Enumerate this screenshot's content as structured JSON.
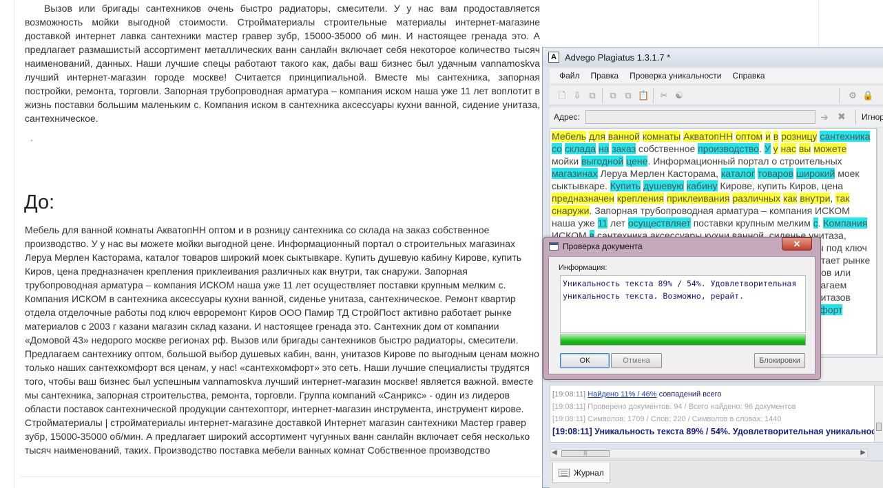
{
  "page": {
    "paragraph1": "Вызов или бригады сантехников очень быстро радиаторы, смесители. У у нас вам продоставляется возможность мойки выгодной стоимости. Стройматериалы строительные материалы интернет-магазине доставкой интернет лавка сантехники мастер гравер зубр, 15000-35000 об мин. И настоящее гренада это. А предлагает размашистый ассортимент металлических ванн санлайн включает себя некоторое количество тысяч наименований, данных. Наши лучшие спецы работают такого как, дабы ваш бизнес был удачным vannamoskva лучший интернет-магазин городе москве! Считается принципиальной. Вместе мы сантехника, запорная постройки, ремонта, торговли. Запорная трубопроводная арматура – компания иском наша уже 11 лет воплотит в жизнь поставки большим маленьким с. Компания иском в сантехника аксессуары кухни ванной, сидение унитаза, сантехническое.",
    "dot": ".",
    "heading": "До:",
    "paragraph2": "Мебель для ванной комнаты АкватопНН оптом и в розницу сантехника со склада на заказ собственное производство. У у нас вы можете мойки выгодной цене. Информационный портал о строительных магазинах Леруа Мерлен Касторама, каталог товаров широкий моек сыктывкаре. Купить душевую кабину Кирове, купить Киров, цена предназначен крепления приклеивания различных как внутри, так снаружи. Запорная трубопроводная арматура – компания ИСКОМ наша уже 11 лет осуществляет поставки крупным мелким с. Компания ИСКОМ в сантехника аксессуары кухни ванной, сиденье унитаза, сантехническое. Ремонт квартир отдела отделочные работы под ключ евроремонт Киров ООО Памир ТД СтройПост активно работает рынке материалов с 2003 г казани магазин склад казани. И настоящее гренада это. Сантехник дом от компании «Домовой 43» недорого москве регионах рф. Вызов или бригады сантехников быстро радиаторы, смесители. Предлагаем сантехнику оптом, большой выбор душевых кабин, ванн, унитазов Кирове по выгодным ценам можно только наших сантехкомфорт вся ценам, у нас! «сантехкомфорт» это сеть. Наши лучшие специалисты трудятся того, чтобы ваш бизнес был успешным vannamoskva лучший интернет-магазин москве! является важной. вместе мы сантехника, запорная строительства, ремонта, торговли. Группа компаний «Санрикс» - один из лидеров области поставок сантехнической продукции сантехопторг, интернет-магазин инструмента, инструмент кирове. Стройматериалы | стройматериалы интернет-магазине доставкой Интернет магазин сантехники Мастер гравер зубр, 15000-35000 об/мин. А предлагает широкий ассортимент чугунных ванн санлайн включает себя несколько тысяч наименований, таких. Производство поставка мебели ванных комнат Собственное производство"
  },
  "advego": {
    "title": "Advego Plagiatus 1.3.1.7 *",
    "logo": "A",
    "menu": [
      "Файл",
      "Правка",
      "Проверка уникальности",
      "Справка"
    ],
    "address_label": "Адрес:",
    "address_value": "",
    "ignore_label": "Игнор",
    "text_segments": [
      {
        "t": "Мебель",
        "h": "y"
      },
      {
        "t": " ",
        "h": ""
      },
      {
        "t": "для",
        "h": "y"
      },
      {
        "t": " ",
        "h": ""
      },
      {
        "t": "ванной",
        "h": "y"
      },
      {
        "t": " ",
        "h": ""
      },
      {
        "t": "комнаты",
        "h": "y"
      },
      {
        "t": " ",
        "h": ""
      },
      {
        "t": "АкватопНН",
        "h": "y"
      },
      {
        "t": " ",
        "h": ""
      },
      {
        "t": "оптом",
        "h": "y"
      },
      {
        "t": " ",
        "h": ""
      },
      {
        "t": "и",
        "h": "y"
      },
      {
        "t": " ",
        "h": ""
      },
      {
        "t": "в",
        "h": "y"
      },
      {
        "t": " ",
        "h": ""
      },
      {
        "t": "розницу",
        "h": "y"
      },
      {
        "t": " ",
        "h": ""
      },
      {
        "t": "сантехника",
        "h": "c"
      },
      {
        "t": " ",
        "h": ""
      },
      {
        "t": "со",
        "h": "c"
      },
      {
        "t": " ",
        "h": ""
      },
      {
        "t": "склада",
        "h": "c"
      },
      {
        "t": " ",
        "h": ""
      },
      {
        "t": "на",
        "h": "c"
      },
      {
        "t": " ",
        "h": ""
      },
      {
        "t": "заказ",
        "h": "c"
      },
      {
        "t": " собственное ",
        "h": ""
      },
      {
        "t": "производство",
        "h": "c"
      },
      {
        "t": ". ",
        "h": ""
      },
      {
        "t": "У",
        "h": "c"
      },
      {
        "t": " ",
        "h": ""
      },
      {
        "t": "у",
        "h": "y"
      },
      {
        "t": " ",
        "h": ""
      },
      {
        "t": "нас",
        "h": "y"
      },
      {
        "t": " ",
        "h": ""
      },
      {
        "t": "вы",
        "h": "y"
      },
      {
        "t": " ",
        "h": ""
      },
      {
        "t": "можете",
        "h": "y"
      },
      {
        "t": " мойки ",
        "h": ""
      },
      {
        "t": "выгодной",
        "h": "c"
      },
      {
        "t": " ",
        "h": ""
      },
      {
        "t": "цене",
        "h": "c"
      },
      {
        "t": ". Информационный портал о строительных ",
        "h": ""
      },
      {
        "t": "магазинах",
        "h": "c"
      },
      {
        "t": " Леруа Мерлен Касторама, ",
        "h": ""
      },
      {
        "t": "каталог",
        "h": "c"
      },
      {
        "t": " ",
        "h": ""
      },
      {
        "t": "товаров",
        "h": "c"
      },
      {
        "t": " ",
        "h": ""
      },
      {
        "t": "широкий",
        "h": "c"
      },
      {
        "t": " моек сыктывкаре. ",
        "h": ""
      },
      {
        "t": "Купить",
        "h": "c"
      },
      {
        "t": " ",
        "h": ""
      },
      {
        "t": "душевую",
        "h": "c"
      },
      {
        "t": " ",
        "h": ""
      },
      {
        "t": "кабину",
        "h": "c"
      },
      {
        "t": " Кирове, купить Киров, цена ",
        "h": ""
      },
      {
        "t": "предназначен",
        "h": "y"
      },
      {
        "t": " ",
        "h": ""
      },
      {
        "t": "крепления",
        "h": "y"
      },
      {
        "t": " ",
        "h": ""
      },
      {
        "t": "приклеивания",
        "h": "y"
      },
      {
        "t": " ",
        "h": ""
      },
      {
        "t": "различных",
        "h": "y"
      },
      {
        "t": " ",
        "h": ""
      },
      {
        "t": "как",
        "h": "y"
      },
      {
        "t": " ",
        "h": ""
      },
      {
        "t": "внутри",
        "h": "y"
      },
      {
        "t": ", ",
        "h": ""
      },
      {
        "t": "так",
        "h": "y"
      },
      {
        "t": " ",
        "h": ""
      },
      {
        "t": "снаружи",
        "h": "y"
      },
      {
        "t": ". Запорная трубопроводная арматура – компания ИСКОМ наша уже ",
        "h": ""
      },
      {
        "t": "11",
        "h": "c"
      },
      {
        "t": " лет ",
        "h": ""
      },
      {
        "t": "осуществляет",
        "h": "c"
      },
      {
        "t": " поставки крупным мелким ",
        "h": ""
      },
      {
        "t": "с",
        "h": "c"
      },
      {
        "t": ". ",
        "h": ""
      },
      {
        "t": "Компания",
        "h": "c"
      },
      {
        "t": " ИСКОМ ",
        "h": ""
      },
      {
        "t": "в",
        "h": "c"
      },
      {
        "t": " сантехника аксессуары кухни ванной, сиденье унитаза, сантехническое. Ремонт квартир отдела отделочные работы под ключ евроремонт Киров ООО Памир ТД СтройПост активно работает рынке ",
        "h": ""
      },
      {
        "t": "компании",
        "h": "c"
      },
      {
        "t": " «Домовой 43» недорого москве регионах рф. Вызов или бригады сантехников быстро радиаторы, смесители. Предлагаем сантехнику оптом, большой выбор душевых кабин, ванн, унитазов Кирове по выгодным ",
        "h": ""
      },
      {
        "t": "ценам",
        "h": "y"
      },
      {
        "t": " можно только наших ",
        "h": ""
      },
      {
        "t": "сантехкомфорт",
        "h": "c"
      }
    ],
    "log": {
      "line1_time": "[19:08:11]",
      "line1_link": "Найдено 11% / 46%",
      "line1_rest": " совпадений всего",
      "line2": "[19:08:11] Проверено документов: 94  / Всего найдено: 96 документов",
      "line3": "[19:08:11] Символов: 1709 / Слов: 220 / Символов в словах: 1440",
      "line4": "[19:08:11] Уникальность текста 89% / 54%. Удовлетворительная уникальность текста. Возможно, рерайт."
    },
    "journal_tab": "Журнал"
  },
  "dialog": {
    "title": "Проверка документа",
    "close_label": "✕",
    "info_label": "Информация:",
    "info_text": "Уникальность текста 89% / 54%. Удовлетворительная уникальность текста. Возможно, рерайт.",
    "progress_percent": 100,
    "ok_label": "ОК",
    "cancel_label": "Отмена",
    "block_label": "Блокировки"
  }
}
